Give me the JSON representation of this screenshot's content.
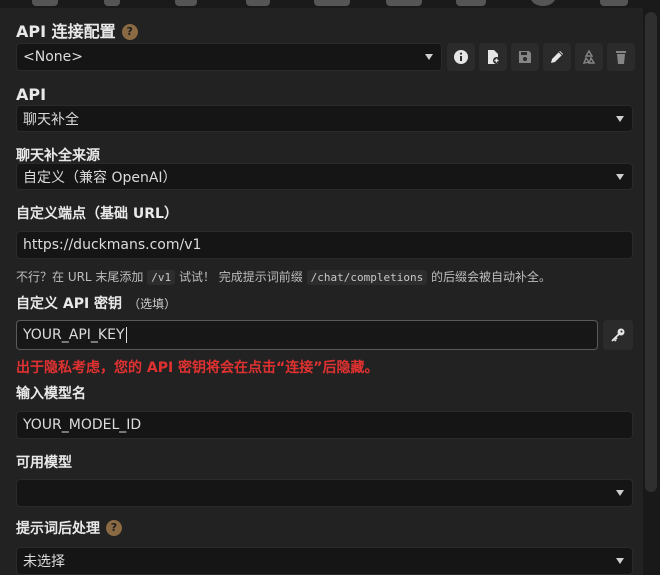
{
  "connection": {
    "title": "API 连接配置",
    "help": "?",
    "profile_value": "<None>"
  },
  "api": {
    "label": "API",
    "value": "聊天补全"
  },
  "source": {
    "label": "聊天补全来源",
    "value": "自定义（兼容 OpenAI）"
  },
  "endpoint": {
    "label": "自定义端点（基础 URL）",
    "value": "https://duckmans.com/v1",
    "hint_a": "不行？在 URL 末尾添加",
    "hint_code1": "/v1",
    "hint_b": "试试！ 完成提示词前缀",
    "hint_code2": "/chat/completions",
    "hint_c": "的后缀会被自动补全。"
  },
  "apikey": {
    "label": "自定义 API 密钥",
    "optional": "（选填）",
    "value": "YOUR_API_KEY",
    "warning": "出于隐私考虑，您的 API 密钥将会在点击“连接”后隐藏。"
  },
  "model": {
    "label": "输入模型名",
    "value": "YOUR_MODEL_ID"
  },
  "available": {
    "label": "可用模型",
    "value": ""
  },
  "postprocess": {
    "label": "提示词后处理",
    "help": "?",
    "value": "未选择"
  },
  "colors": {
    "background": "#222222",
    "field": "#151515",
    "warning": "#e03131",
    "help_badge": "#8a6a42"
  }
}
